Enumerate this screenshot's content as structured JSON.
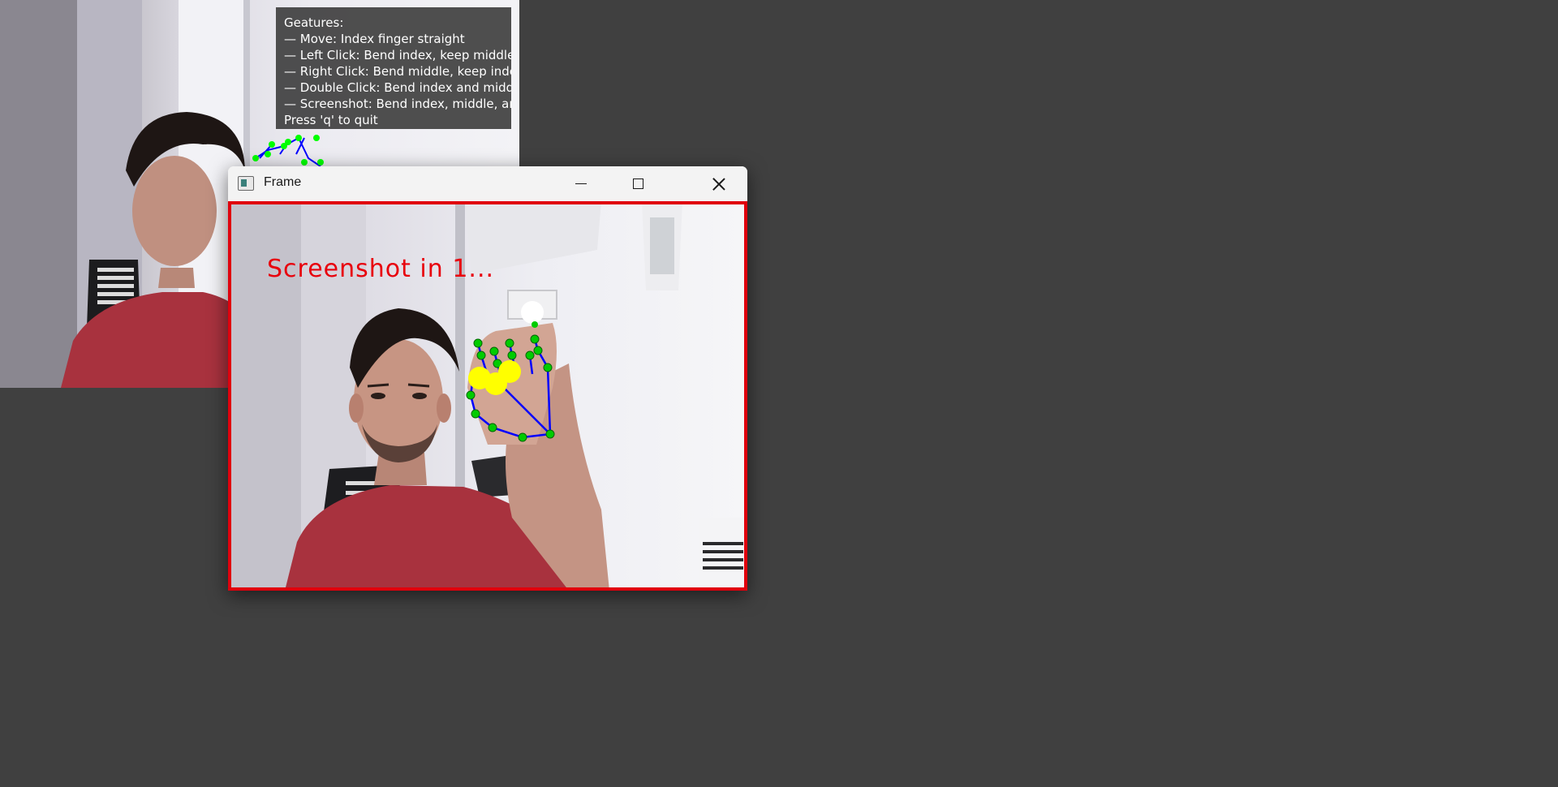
{
  "background_window": {
    "gestures_overlay": {
      "title": "Geatures:",
      "lines": [
        "— Move: Index finger straight",
        "— Left Click: Bend index, keep middle straight",
        "— Right Click: Bend middle, keep index straight",
        "— Double Click: Bend index and middle",
        "— Screenshot: Bend index, middle, and ring"
      ],
      "quit_hint": "Press 'q' to quit"
    }
  },
  "frame_window": {
    "title": "Frame",
    "icons": {
      "app": "window-app-icon",
      "minimize": "minimize-icon",
      "maximize": "maximize-icon",
      "close": "close-icon"
    },
    "status_text": "Screenshot in 1...",
    "border_color": "#e0000c",
    "status_color": "#e8000c"
  },
  "colors": {
    "desktop": "#404040",
    "landmark_fill": "#00ff00",
    "hand_connection": "#0000ff",
    "fingertip_marker": "#ffff00",
    "cursor_marker": "#ffffff"
  }
}
